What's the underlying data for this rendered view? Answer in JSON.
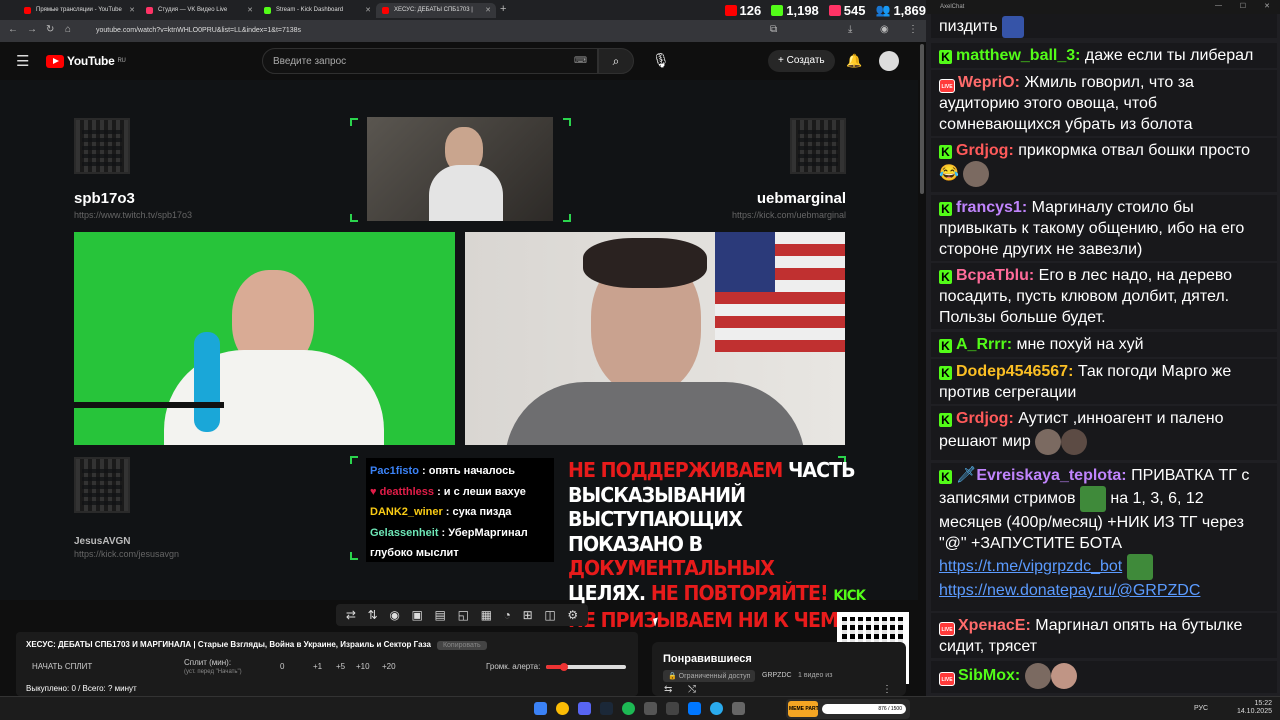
{
  "browser": {
    "tabs": [
      {
        "label": "Прямые трансляции - YouTube",
        "color": "#ff0000"
      },
      {
        "label": "Студия — VK Видео Live",
        "color": "#ff3366"
      },
      {
        "label": "Stream - Kick Dashboard",
        "color": "#53fc18"
      },
      {
        "label": "ХЕСУС: ДЕБАТЫ СПБ1703 |",
        "color": "#ff0000"
      }
    ],
    "url": "youtube.com/watch?v=ktnWHLO0PRU&list=LL&index=1&t=7138s"
  },
  "viewer_stats": [
    {
      "platform": "youtube",
      "count": "126",
      "color": "#ff0000"
    },
    {
      "platform": "kick",
      "count": "1,198",
      "color": "#53fc18"
    },
    {
      "platform": "vk",
      "count": "545",
      "color": "#ff3366"
    },
    {
      "platform": "total",
      "count": "1,869",
      "color": "#3b82f6"
    }
  ],
  "youtube": {
    "logo": "YouTube",
    "region": "RU",
    "search_placeholder": "Введите запрос",
    "create_label": "+ Создать"
  },
  "overlay": {
    "left_name": "spb17o3",
    "left_url": "https://www.twitch.tv/spb17o3",
    "right_name": "uebmarginal",
    "right_url": "https://kick.com/uebmarginal",
    "bottom_name": "JesusAVGN",
    "bottom_url": "https://kick.com/jesusavgn"
  },
  "mini_chat": [
    {
      "user": "Pac1fisto",
      "text": " : опять началось",
      "color": "#3b82f6"
    },
    {
      "user": "deatthless",
      "text": " : и с леши вахуе",
      "color": "#e11d48"
    },
    {
      "user": "DANK2_winer",
      "text": " : сука пизда",
      "color": "#facc15"
    },
    {
      "user": "Gelassenheit",
      "text": " : УберМаргинал глубоко мыслит",
      "color": "#6ee7b7"
    }
  ],
  "warning": {
    "line1_red": "НЕ ПОДДЕРЖИВАЕМ",
    "line1_white": " ЧАСТЬ",
    "line2": "ВЫСКАЗЫВАНИЙ ВЫСТУПАЮЩИХ",
    "line3_white": "ПОКАЗАНО В ",
    "line3_red": "ДОКУМЕНТАЛЬНЫХ",
    "line4_white": "ЦЕЛЯХ. ",
    "line4_red": "НЕ ПОВТОРЯЙТЕ!",
    "kick": "KICK",
    "line5": "НЕ ПРИЗЫВАЕМ НИ К ЧЕМУ!"
  },
  "panel": {
    "title": "ХЕСУС: ДЕБАТЫ СПБ1703 И МАРГИНАЛА | Старые Взгляды, Война в Украине, Израиль и Сектор Газа",
    "tag": "Копировать",
    "start_split": "НАЧАТЬ СПЛИТ",
    "split_label": "Сплит (мин):",
    "split_hint": "(уст. перед \"Начать\")",
    "split_values": [
      "0",
      "+1",
      "+5",
      "+10",
      "+20"
    ],
    "alert_label": "Громк. алерта:",
    "payout": "Выкуплено: 0 / Всего: ? минут"
  },
  "liked": {
    "title": "Понравившиеся",
    "access": "Ограниченный доступ",
    "owner": "GRPZDC",
    "count": "1 видео из"
  },
  "chat_window_title": "AxelChat",
  "chat": [
    {
      "badge": "",
      "user": "",
      "text": "пиздить",
      "color": "#ffffff"
    },
    {
      "badge": "kick",
      "user": "matthew_ball_3:",
      "text": " даже если ты либерал",
      "color": "#53fc18"
    },
    {
      "badge": "live",
      "user": "WepriO:",
      "text": " Жмиль говорил, что за аудиторию этого овоща, чтоб сомневающихся убрать из болота",
      "color": "#ff6b6b"
    },
    {
      "badge": "kick",
      "user": "Grdjog:",
      "text": " прикормка отвал бошки просто😂",
      "color": "#ff5a5a"
    },
    {
      "badge": "kick",
      "user": "francys1:",
      "text": " Маргиналу стоило бы привыкать к такому общению, ибо на его стороне других не завезли)",
      "color": "#c084fc"
    },
    {
      "badge": "kick",
      "user": "BcpaTblu:",
      "text": " Его в лес надо, на дерево посадить, пусть клювом долбит, дятел. Пользы больше будет.",
      "color": "#ff6b9a"
    },
    {
      "badge": "kick",
      "user": "A_Rrrr:",
      "text": " мне похуй на хуй",
      "color": "#53fc18"
    },
    {
      "badge": "kick",
      "user": "Dodep4546567:",
      "text": " Так погоди Марго же против сегрегации",
      "color": "#fbbf24"
    },
    {
      "badge": "kick",
      "user": "Grdjog:",
      "text": " Аутист ,инноагент и палено решают мир",
      "color": "#ff5a5a"
    },
    {
      "badge": "kick",
      "user": "Evreiskaya_teplota:",
      "text": " ПРИВАТКА ТГ с записями стримов",
      "text2": " на 1, 3, 6, 12 месяцев (400р/месяц) +НИК ИЗ ТГ через \"@\" +ЗАПУСТИТЕ БОТА",
      "link1": "https://t.me/vipgrpzdc_bot",
      "link2": "https://new.donatepay.ru/@GRPZDC",
      "color": "#c084fc"
    },
    {
      "badge": "live",
      "user": "ХренасЕ:",
      "text": " Маргинал опять на бутылке сидит, трясет",
      "color": "#ff6b6b"
    },
    {
      "badge": "live",
      "user": "SibMox:",
      "text": "",
      "color": "#53fc18"
    }
  ],
  "taskbar": {
    "lang": "РУС",
    "time": "15:22",
    "date": "14.10.2025",
    "meme_party": "MEME PARTY",
    "meme_progress": "876 / 1500"
  }
}
